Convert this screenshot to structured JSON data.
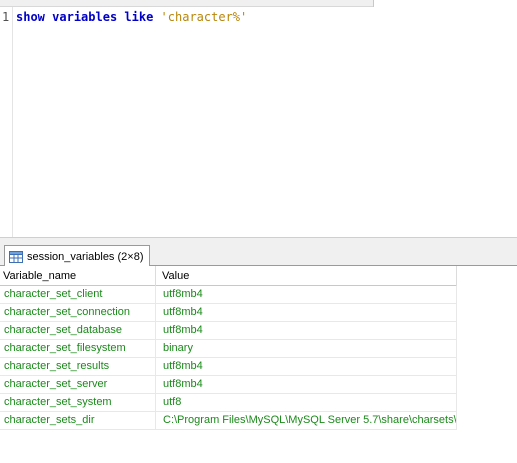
{
  "editor": {
    "line_number": "1",
    "code": {
      "kw1": "show",
      "kw2": "variables",
      "kw3": "like",
      "str": "'character%'"
    }
  },
  "result_tab": {
    "label": "session_variables (2×8)",
    "icon": "table-icon"
  },
  "grid": {
    "columns": [
      "Variable_name",
      "Value"
    ],
    "rows": [
      [
        "character_set_client",
        "utf8mb4"
      ],
      [
        "character_set_connection",
        "utf8mb4"
      ],
      [
        "character_set_database",
        "utf8mb4"
      ],
      [
        "character_set_filesystem",
        "binary"
      ],
      [
        "character_set_results",
        "utf8mb4"
      ],
      [
        "character_set_server",
        "utf8mb4"
      ],
      [
        "character_set_system",
        "utf8"
      ],
      [
        "character_sets_dir",
        "C:\\Program Files\\MySQL\\MySQL Server 5.7\\share\\charsets\\"
      ]
    ],
    "value_color": "#1a8a1a"
  }
}
